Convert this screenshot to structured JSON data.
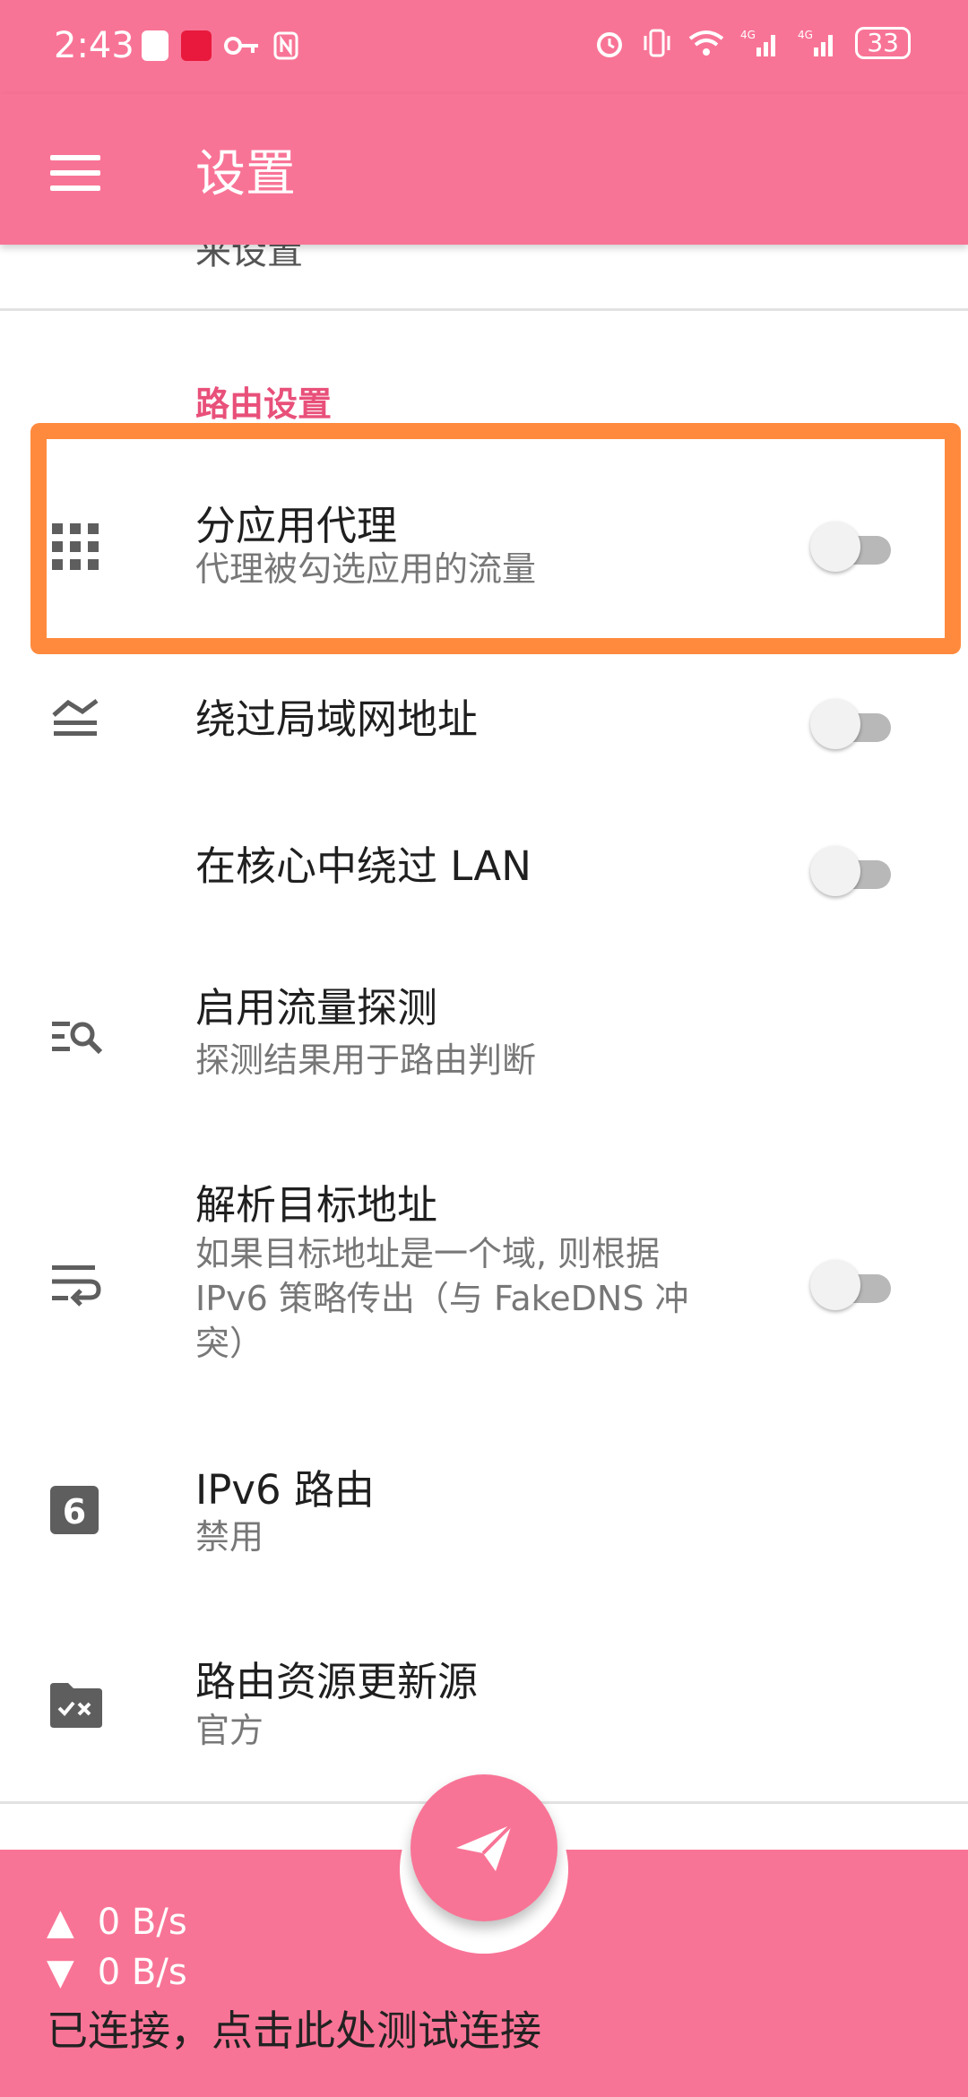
{
  "status_bar": {
    "time": "2:43",
    "battery": "33",
    "left_icons": [
      "app-icon",
      "app-icon-red",
      "key-icon",
      "nfc-icon"
    ],
    "right_icons": [
      "alarm-icon",
      "vibrate-icon",
      "wifi-icon",
      "signal-4g-icon",
      "signal-4g-icon"
    ]
  },
  "toolbar": {
    "title": "设置",
    "menu_icon": "menu-icon"
  },
  "content": {
    "prev_item_partial": "来设置",
    "section_header": "路由设置",
    "items": [
      {
        "icon": "apps-grid-icon",
        "title": "分应用代理",
        "subtitle": "代理被勾选应用的流量",
        "switch": false
      },
      {
        "icon": "lan-bypass-icon",
        "title": "绕过局域网地址",
        "switch": false
      },
      {
        "title": "在核心中绕过 LAN",
        "switch": false
      },
      {
        "icon": "traffic-search-icon",
        "title": "启用流量探测",
        "subtitle": "探测结果用于路由判断"
      },
      {
        "icon": "wrap-text-icon",
        "title": "解析目标地址",
        "subtitle": "如果目标地址是一个域, 则根据 IPv6 策略传出（与 FakeDNS 冲突）",
        "switch": false
      },
      {
        "icon": "ipv6-icon",
        "title": "IPv6 路由",
        "subtitle": "禁用"
      },
      {
        "icon": "folder-check-icon",
        "title": "路由资源更新源",
        "subtitle": "官方"
      }
    ]
  },
  "bottom_bar": {
    "upload": "0 B/s",
    "download": "0 B/s",
    "status": "已连接，点击此处测试连接",
    "fab_icon": "send-icon"
  },
  "colors": {
    "primary": "#f87496",
    "accent": "#e8507a",
    "highlight": "#ff8a3d"
  }
}
